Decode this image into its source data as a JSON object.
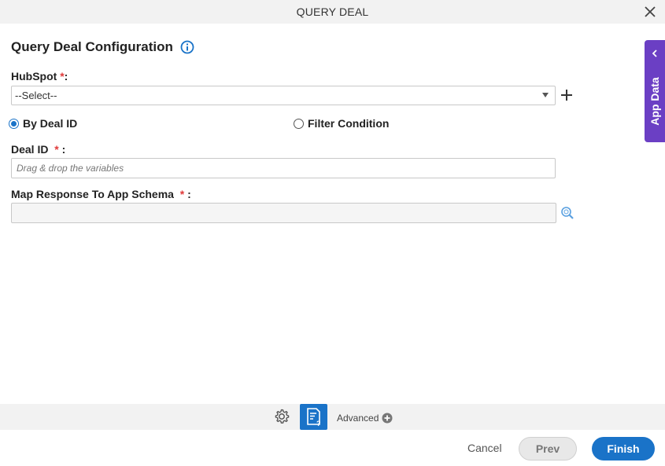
{
  "window": {
    "title": "QUERY DEAL"
  },
  "heading": {
    "title": "Query Deal Configuration"
  },
  "hubspot": {
    "label": "HubSpot",
    "required_mark": "*",
    "suffix": ":",
    "selected": "--Select--"
  },
  "mode": {
    "options": [
      {
        "label": "By Deal ID",
        "checked": true
      },
      {
        "label": "Filter Condition",
        "checked": false
      }
    ]
  },
  "deal_id": {
    "label": "Deal ID",
    "required_mark": "*",
    "suffix": ":",
    "placeholder": "Drag & drop the variables",
    "value": ""
  },
  "map_response": {
    "label": "Map Response To App Schema",
    "required_mark": "*",
    "suffix": ":",
    "value": ""
  },
  "app_data_tab": {
    "label": "App Data"
  },
  "toolbar": {
    "advanced_label": "Advanced"
  },
  "buttons": {
    "cancel": "Cancel",
    "prev": "Prev",
    "finish": "Finish"
  },
  "colors": {
    "accent": "#1a73c8",
    "app_data": "#6b3fc4",
    "required": "#e03a3a"
  },
  "icons": [
    "close-icon",
    "info-icon",
    "chevron-down-icon",
    "plus-icon",
    "lookup-icon",
    "chevron-left-icon",
    "gear-icon",
    "document-help-icon",
    "plus-circle-icon"
  ]
}
